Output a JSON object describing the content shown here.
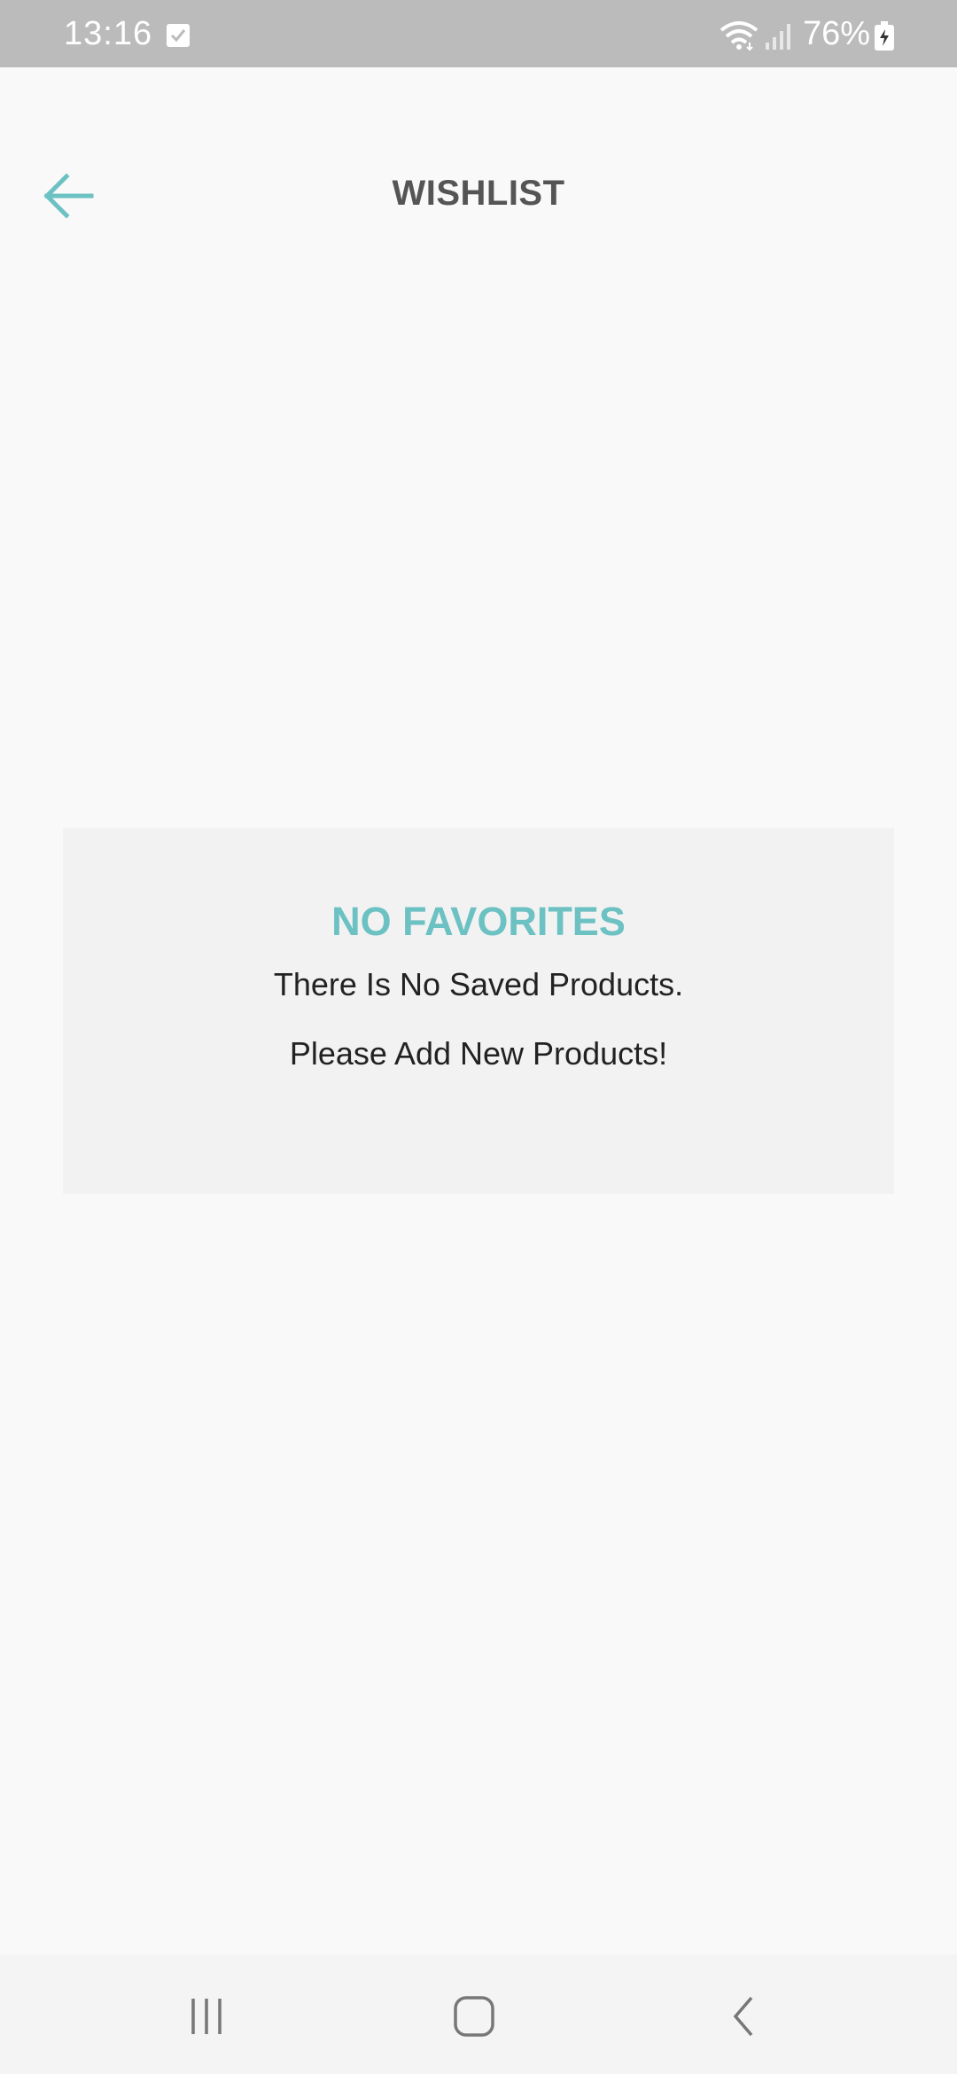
{
  "status_bar": {
    "time": "13:16",
    "battery_percent": "76%",
    "icons": [
      "checkbox-notification-icon",
      "wifi-icon",
      "signal-icon",
      "battery-charging-icon"
    ]
  },
  "header": {
    "title": "WISHLIST",
    "back_icon": "arrow-left-icon"
  },
  "empty_state": {
    "title": "NO FAVORITES",
    "line1": "There Is No Saved Products.",
    "line2": "Please Add New Products!"
  },
  "nav_bar": {
    "icons": [
      "recents-icon",
      "home-icon",
      "back-icon"
    ]
  },
  "colors": {
    "accent": "#6cc1c3",
    "status_bar_bg": "#bbbbbb",
    "background": "#f9f9f9",
    "card_bg": "#f2f2f2",
    "title_text": "#555555",
    "body_text": "#222222"
  }
}
